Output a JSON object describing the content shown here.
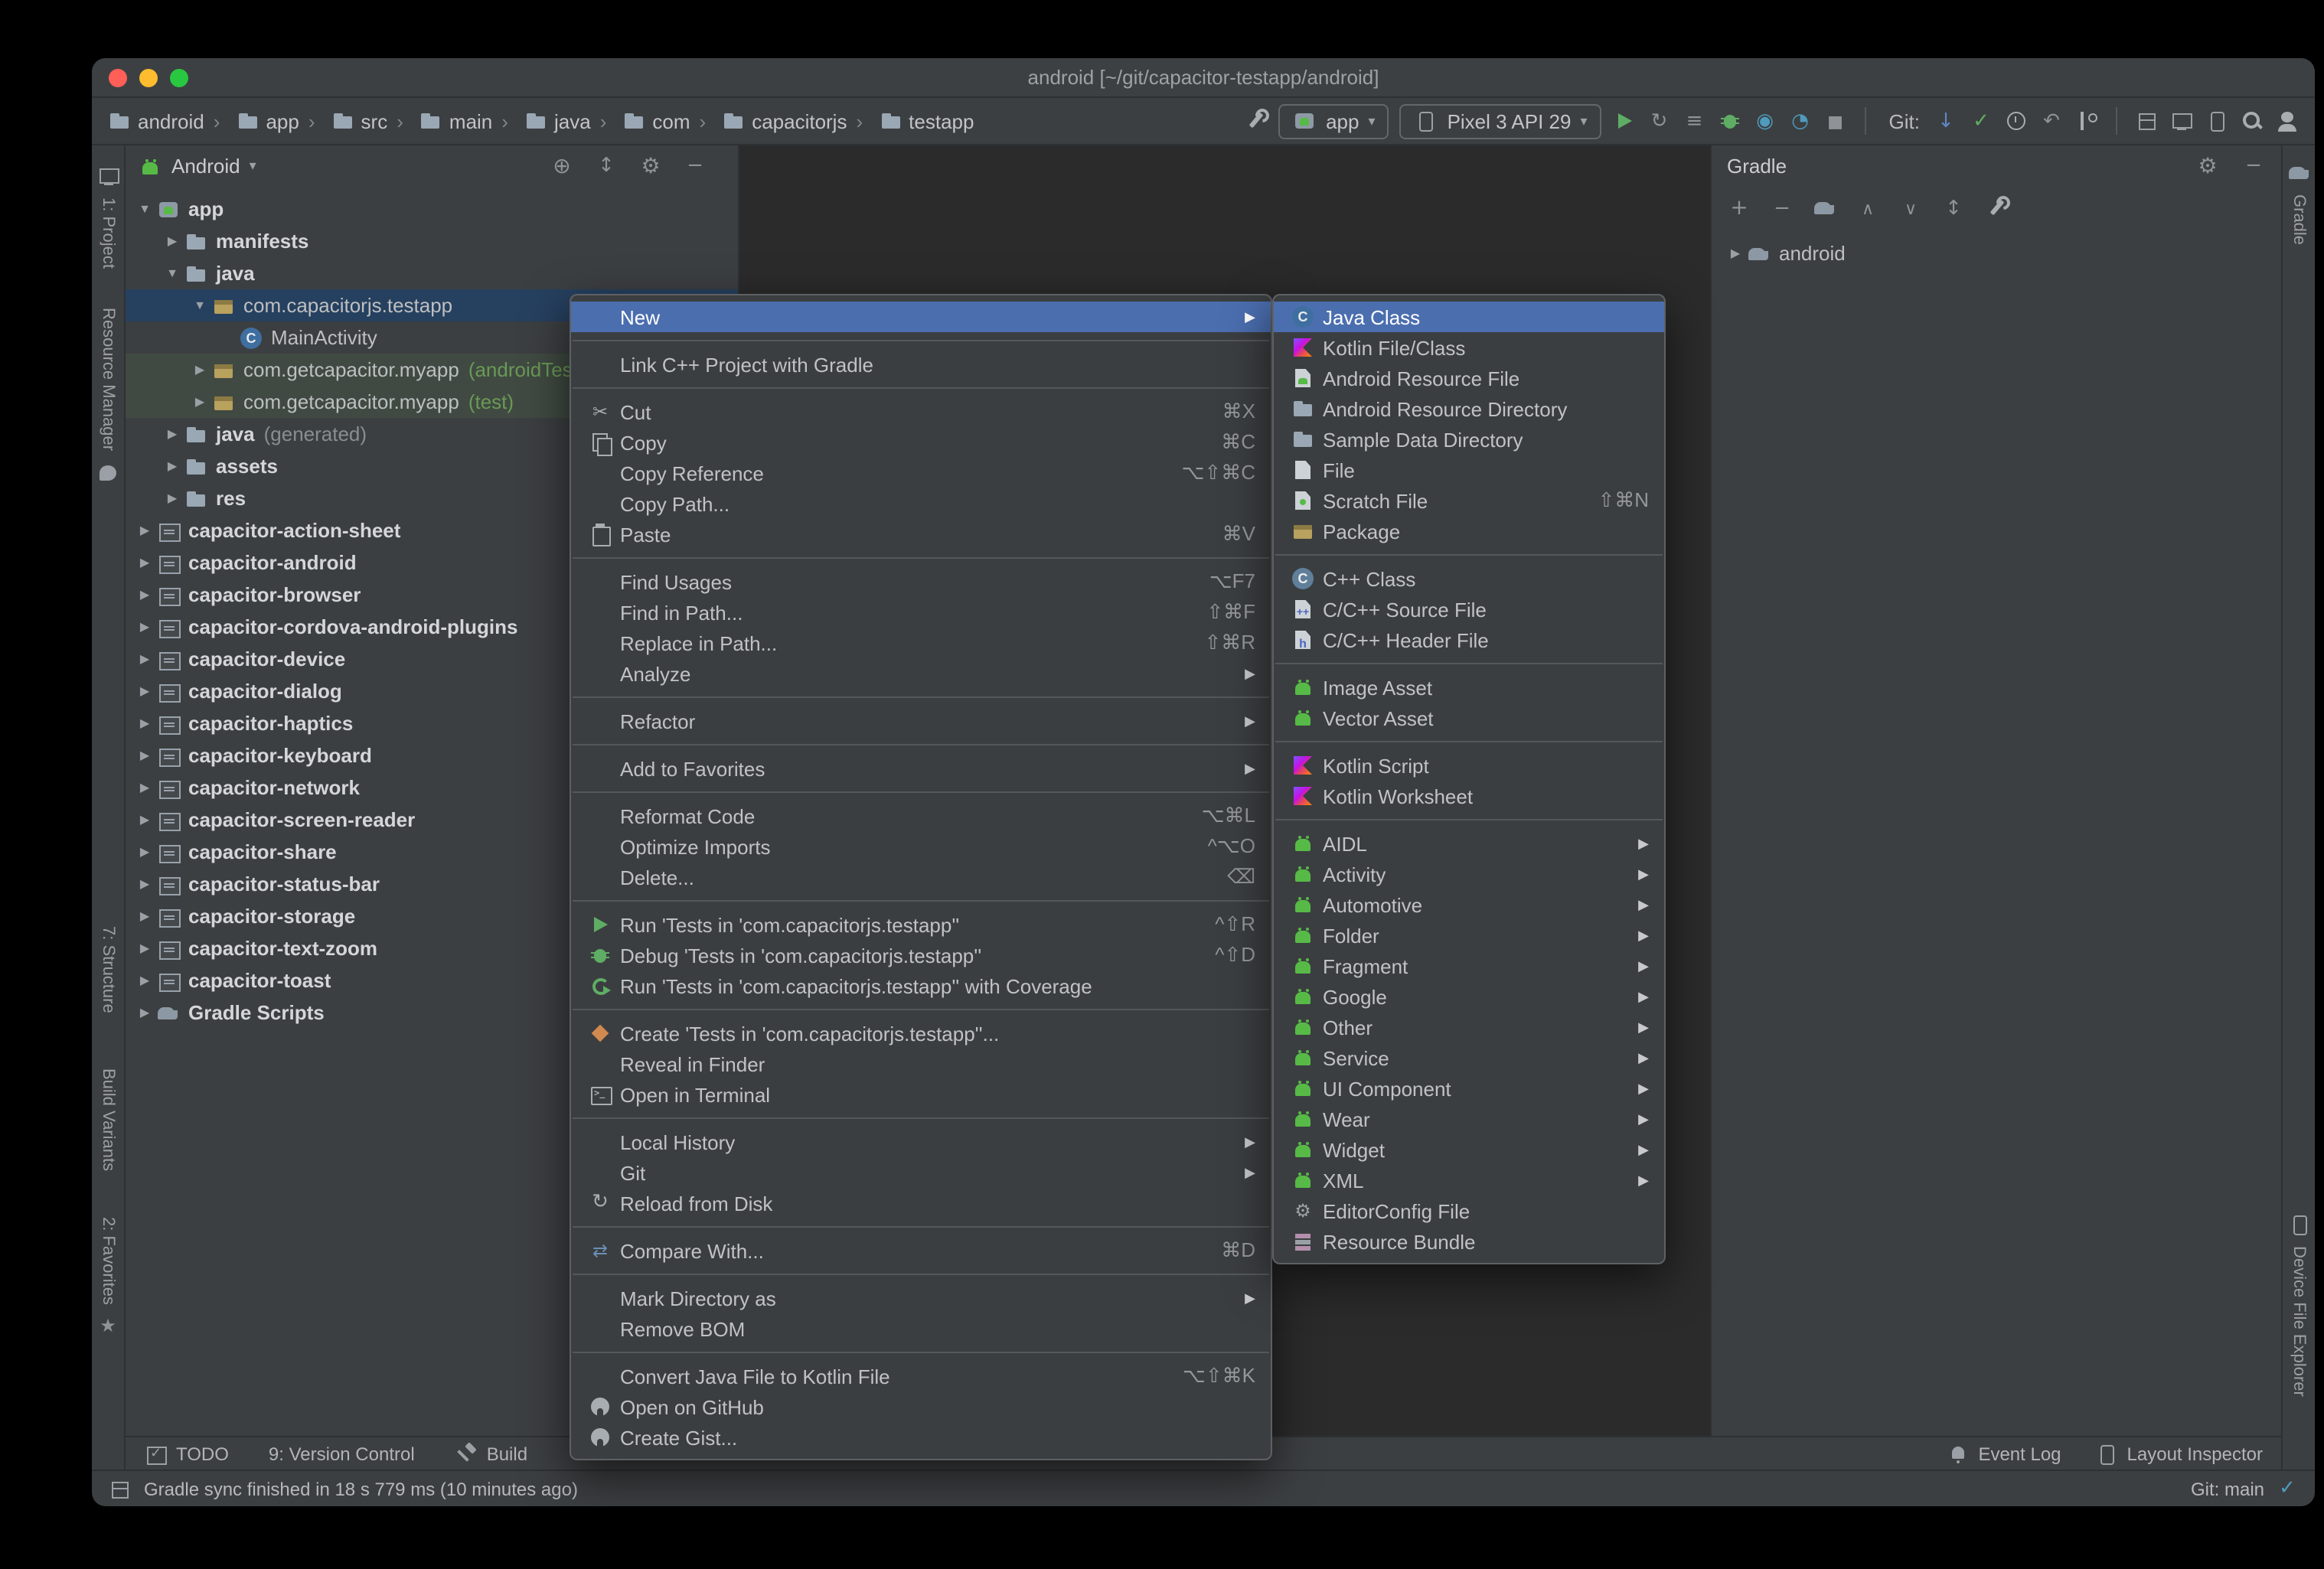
{
  "colors": {
    "menu_selection": "#4b6eaf",
    "tree_selection": "#26405f",
    "window_bg": "#3c3f41",
    "editor_bg": "#2b2b2b",
    "popup_bg": "#3b3e40",
    "accent_green": "#5fad65",
    "android_green": "#57ba47",
    "test_source_green": "#6a9955",
    "traffic_close": "#ff5f57",
    "traffic_minimize": "#febc2e",
    "traffic_zoom": "#28c840"
  },
  "titlebar": {
    "title": "android [~/git/capacitor-testapp/android]"
  },
  "toolbar": {
    "breadcrumbs": [
      {
        "label": "android"
      },
      {
        "label": "app"
      },
      {
        "label": "src"
      },
      {
        "label": "main"
      },
      {
        "label": "java"
      },
      {
        "label": "com"
      },
      {
        "label": "capacitorjs"
      },
      {
        "label": "testapp"
      }
    ],
    "run_config": "app",
    "device": "Pixel 3 API 29",
    "git_label": "Git:"
  },
  "left_stripe": {
    "items": [
      {
        "label": "1: Project",
        "iconTop": "project"
      },
      {
        "label": "Resource Manager",
        "iconBottom": "palette"
      },
      {
        "label": "7: Structure"
      },
      {
        "label": "Build Variants"
      },
      {
        "label": "2: Favorites",
        "iconBottom": "star"
      }
    ]
  },
  "right_stripe": {
    "top_items": [
      {
        "label": "Gradle",
        "iconTop": "gradle"
      }
    ],
    "bottom_items": [
      {
        "label": "Device File Explorer",
        "iconTop": "phone"
      }
    ]
  },
  "project_panel": {
    "view_label": "Android",
    "tree": [
      {
        "indent": 0,
        "exp": "▼",
        "icon": "app-module",
        "label": "app",
        "labelCls": "bold"
      },
      {
        "indent": 1,
        "exp": "▶",
        "icon": "folder",
        "label": "manifests",
        "labelCls": "bold"
      },
      {
        "indent": 1,
        "exp": "▼",
        "icon": "folder",
        "label": "java",
        "labelCls": "bold"
      },
      {
        "indent": 2,
        "exp": "▼",
        "icon": "package",
        "label": "com.capacitorjs.testapp",
        "cls": "selected"
      },
      {
        "indent": 3,
        "exp": "",
        "icon": "class",
        "label": "MainActivity"
      },
      {
        "indent": 2,
        "exp": "▶",
        "icon": "package",
        "label": "com.getcapacitor.myapp",
        "suffix": "(androidTest)",
        "suffixCls": "green",
        "cls": "testsrc"
      },
      {
        "indent": 2,
        "exp": "▶",
        "icon": "package",
        "label": "com.getcapacitor.myapp",
        "suffix": "(test)",
        "suffixCls": "green",
        "cls": "testsrc"
      },
      {
        "indent": 1,
        "exp": "▶",
        "icon": "folder",
        "label": "java",
        "suffix": "(generated)",
        "suffixCls": "dim",
        "labelCls": "bold"
      },
      {
        "indent": 1,
        "exp": "▶",
        "icon": "folder",
        "label": "assets",
        "labelCls": "bold"
      },
      {
        "indent": 1,
        "exp": "▶",
        "icon": "folder-res",
        "label": "res",
        "labelCls": "bold"
      },
      {
        "indent": 0,
        "exp": "▶",
        "icon": "module",
        "label": "capacitor-action-sheet",
        "labelCls": "bold"
      },
      {
        "indent": 0,
        "exp": "▶",
        "icon": "module",
        "label": "capacitor-android",
        "labelCls": "bold"
      },
      {
        "indent": 0,
        "exp": "▶",
        "icon": "module",
        "label": "capacitor-browser",
        "labelCls": "bold"
      },
      {
        "indent": 0,
        "exp": "▶",
        "icon": "module",
        "label": "capacitor-cordova-android-plugins",
        "labelCls": "bold"
      },
      {
        "indent": 0,
        "exp": "▶",
        "icon": "module",
        "label": "capacitor-device",
        "labelCls": "bold"
      },
      {
        "indent": 0,
        "exp": "▶",
        "icon": "module",
        "label": "capacitor-dialog",
        "labelCls": "bold"
      },
      {
        "indent": 0,
        "exp": "▶",
        "icon": "module",
        "label": "capacitor-haptics",
        "labelCls": "bold"
      },
      {
        "indent": 0,
        "exp": "▶",
        "icon": "module",
        "label": "capacitor-keyboard",
        "labelCls": "bold"
      },
      {
        "indent": 0,
        "exp": "▶",
        "icon": "module",
        "label": "capacitor-network",
        "labelCls": "bold"
      },
      {
        "indent": 0,
        "exp": "▶",
        "icon": "module",
        "label": "capacitor-screen-reader",
        "labelCls": "bold"
      },
      {
        "indent": 0,
        "exp": "▶",
        "icon": "module",
        "label": "capacitor-share",
        "labelCls": "bold"
      },
      {
        "indent": 0,
        "exp": "▶",
        "icon": "module",
        "label": "capacitor-status-bar",
        "labelCls": "bold"
      },
      {
        "indent": 0,
        "exp": "▶",
        "icon": "module",
        "label": "capacitor-storage",
        "labelCls": "bold"
      },
      {
        "indent": 0,
        "exp": "▶",
        "icon": "module",
        "label": "capacitor-text-zoom",
        "labelCls": "bold"
      },
      {
        "indent": 0,
        "exp": "▶",
        "icon": "module",
        "label": "capacitor-toast",
        "labelCls": "bold"
      },
      {
        "indent": 0,
        "exp": "▶",
        "icon": "gradle",
        "label": "Gradle Scripts",
        "labelCls": "bold"
      }
    ]
  },
  "gradle_panel": {
    "title": "Gradle",
    "tree": [
      {
        "exp": "▶",
        "icon": "gradle",
        "label": "android"
      }
    ]
  },
  "context_menu": {
    "items": [
      {
        "label": "New",
        "arrow": true,
        "cls": "hl"
      },
      {
        "sep": true
      },
      {
        "label": "Link C++ Project with Gradle"
      },
      {
        "sep": true
      },
      {
        "icon": "cut",
        "label": "Cut",
        "shortcut": "⌘X"
      },
      {
        "icon": "copy",
        "label": "Copy",
        "shortcut": "⌘C"
      },
      {
        "label": "Copy Reference",
        "shortcut": "⌥⇧⌘C"
      },
      {
        "label": "Copy Path..."
      },
      {
        "icon": "paste",
        "label": "Paste",
        "shortcut": "⌘V"
      },
      {
        "sep": true
      },
      {
        "label": "Find Usages",
        "shortcut": "⌥F7"
      },
      {
        "label": "Find in Path...",
        "shortcut": "⇧⌘F"
      },
      {
        "label": "Replace in Path...",
        "shortcut": "⇧⌘R"
      },
      {
        "label": "Analyze",
        "arrow": true
      },
      {
        "sep": true
      },
      {
        "label": "Refactor",
        "arrow": true
      },
      {
        "sep": true
      },
      {
        "label": "Add to Favorites",
        "arrow": true
      },
      {
        "sep": true
      },
      {
        "label": "Reformat Code",
        "shortcut": "⌥⌘L"
      },
      {
        "label": "Optimize Imports",
        "shortcut": "^⌥O"
      },
      {
        "label": "Delete...",
        "shortcut": "⌫"
      },
      {
        "sep": true
      },
      {
        "icon": "run",
        "label": "Run 'Tests in 'com.capacitorjs.testapp''",
        "shortcut": "^⇧R"
      },
      {
        "icon": "debug",
        "label": "Debug 'Tests in 'com.capacitorjs.testapp''",
        "shortcut": "^⇧D"
      },
      {
        "icon": "coverage",
        "label": "Run 'Tests in 'com.capacitorjs.testapp'' with Coverage"
      },
      {
        "sep": true
      },
      {
        "icon": "create-test",
        "label": "Create 'Tests in 'com.capacitorjs.testapp''..."
      },
      {
        "label": "Reveal in Finder"
      },
      {
        "icon": "terminal",
        "label": "Open in Terminal"
      },
      {
        "sep": true
      },
      {
        "label": "Local History",
        "arrow": true
      },
      {
        "label": "Git",
        "arrow": true
      },
      {
        "icon": "refresh",
        "label": "Reload from Disk"
      },
      {
        "sep": true
      },
      {
        "icon": "compare",
        "label": "Compare With...",
        "shortcut": "⌘D"
      },
      {
        "sep": true
      },
      {
        "label": "Mark Directory as",
        "arrow": true
      },
      {
        "label": "Remove BOM"
      },
      {
        "sep": true
      },
      {
        "label": "Convert Java File to Kotlin File",
        "shortcut": "⌥⇧⌘K"
      },
      {
        "icon": "github",
        "label": "Open on GitHub"
      },
      {
        "icon": "github",
        "label": "Create Gist..."
      }
    ]
  },
  "new_submenu": {
    "items": [
      {
        "icon": "java-class",
        "label": "Java Class",
        "cls": "hl"
      },
      {
        "icon": "kotlin",
        "label": "Kotlin File/Class"
      },
      {
        "icon": "android-file",
        "label": "Android Resource File"
      },
      {
        "icon": "folder",
        "label": "Android Resource Directory"
      },
      {
        "icon": "folder",
        "label": "Sample Data Directory"
      },
      {
        "icon": "file",
        "label": "File"
      },
      {
        "icon": "scratch",
        "label": "Scratch File",
        "shortcut": "⇧⌘N"
      },
      {
        "icon": "package",
        "label": "Package"
      },
      {
        "sep": true
      },
      {
        "icon": "cpp-class",
        "label": "C++ Class"
      },
      {
        "icon": "cpp-file",
        "label": "C/C++ Source File"
      },
      {
        "icon": "cpp-header",
        "label": "C/C++ Header File"
      },
      {
        "sep": true
      },
      {
        "icon": "android",
        "label": "Image Asset"
      },
      {
        "icon": "android",
        "label": "Vector Asset"
      },
      {
        "sep": true
      },
      {
        "icon": "kotlin",
        "label": "Kotlin Script"
      },
      {
        "icon": "kotlin",
        "label": "Kotlin Worksheet"
      },
      {
        "sep": true
      },
      {
        "icon": "android",
        "label": "AIDL",
        "arrow": true
      },
      {
        "icon": "android",
        "label": "Activity",
        "arrow": true
      },
      {
        "icon": "android",
        "label": "Automotive",
        "arrow": true
      },
      {
        "icon": "android",
        "label": "Folder",
        "arrow": true
      },
      {
        "icon": "android",
        "label": "Fragment",
        "arrow": true
      },
      {
        "icon": "android",
        "label": "Google",
        "arrow": true
      },
      {
        "icon": "android",
        "label": "Other",
        "arrow": true
      },
      {
        "icon": "android",
        "label": "Service",
        "arrow": true
      },
      {
        "icon": "android",
        "label": "UI Component",
        "arrow": true
      },
      {
        "icon": "android",
        "label": "Wear",
        "arrow": true
      },
      {
        "icon": "android",
        "label": "Widget",
        "arrow": true
      },
      {
        "icon": "android",
        "label": "XML",
        "arrow": true
      },
      {
        "icon": "editorconfig",
        "label": "EditorConfig File"
      },
      {
        "icon": "resource-bundle",
        "label": "Resource Bundle"
      }
    ]
  },
  "bottom_bar": {
    "left": [
      {
        "icon": "todo",
        "label": "TODO"
      },
      {
        "label": "9: Version Control"
      },
      {
        "icon": "hammer",
        "label": "Build"
      }
    ],
    "right": [
      {
        "icon": "bell",
        "label": "Event Log"
      },
      {
        "icon": "phone",
        "label": "Layout Inspector"
      }
    ]
  },
  "status_bar": {
    "message": "Gradle sync finished in 18 s 779 ms (10 minutes ago)",
    "git": "Git: main"
  }
}
